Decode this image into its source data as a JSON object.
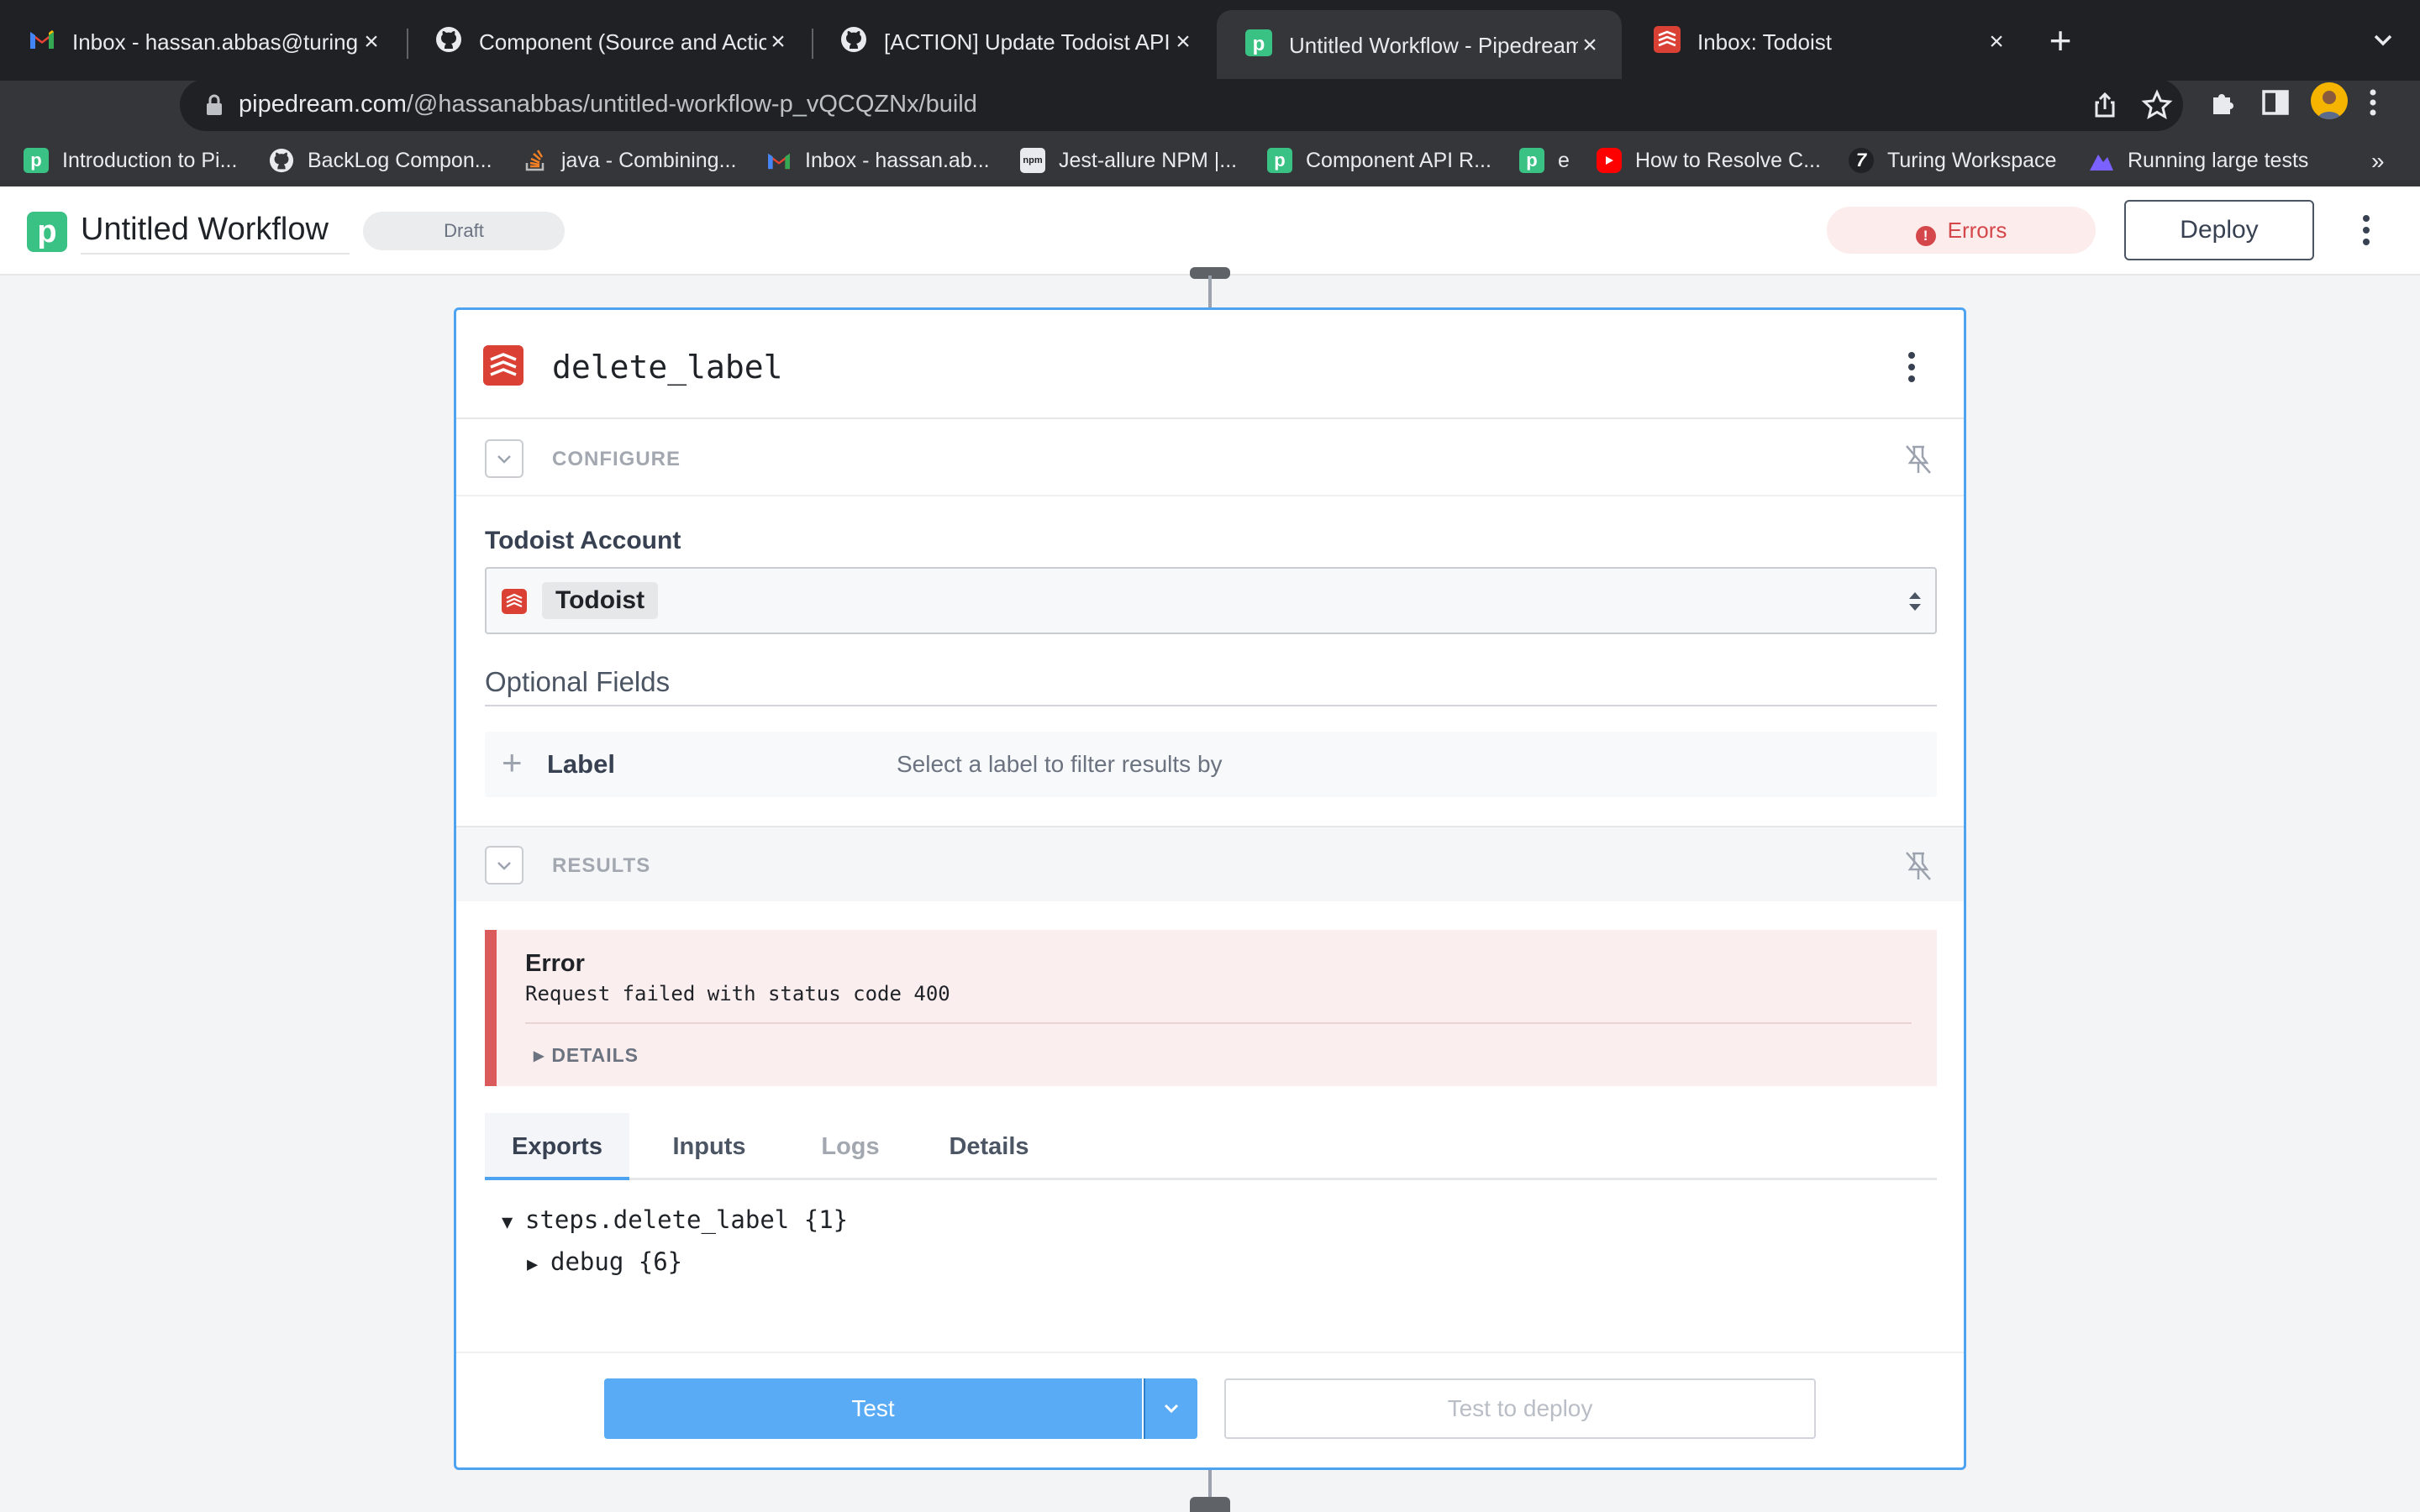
{
  "browser": {
    "tabs": [
      {
        "title": "Inbox - hassan.abbas@turing.c",
        "icon": "gmail-icon"
      },
      {
        "title": "Component (Source and Actior",
        "icon": "github-icon"
      },
      {
        "title": "[ACTION] Update Todoist API f",
        "icon": "github-icon"
      },
      {
        "title": "Untitled Workflow - Pipedream",
        "icon": "pipedream-icon"
      },
      {
        "title": "Inbox: Todoist",
        "icon": "todoist-icon"
      }
    ],
    "url_host": "pipedream.com",
    "url_path": "/@hassanabbas/untitled-workflow-p_vQCQZNx/build",
    "bookmarks": [
      {
        "label": "Introduction to Pi...",
        "icon": "pipedream-icon"
      },
      {
        "label": "BackLog Compon...",
        "icon": "github-icon"
      },
      {
        "label": "java - Combining...",
        "icon": "stackoverflow-icon"
      },
      {
        "label": "Inbox - hassan.ab...",
        "icon": "gmail-icon"
      },
      {
        "label": "Jest-allure NPM |...",
        "icon": "npm-icon"
      },
      {
        "label": "Component API R...",
        "icon": "pipedream-icon"
      },
      {
        "label": "e",
        "icon": "pipedream-icon"
      },
      {
        "label": "How to Resolve C...",
        "icon": "youtube-icon"
      },
      {
        "label": "Turing Workspace",
        "icon": "turing-icon"
      },
      {
        "label": "Running large tests",
        "icon": "mountain-icon"
      }
    ],
    "bookmarks_more": "»"
  },
  "app": {
    "logo_letter": "p",
    "workflow_title": "Untitled Workflow",
    "status": "Draft",
    "errors_label": "Errors",
    "deploy_label": "Deploy"
  },
  "step": {
    "name": "delete_label",
    "configure_label": "CONFIGURE",
    "account_label": "Todoist Account",
    "account_value": "Todoist",
    "optional_title": "Optional Fields",
    "optional_fields": [
      {
        "label": "Label",
        "description": "Select a label to filter results by"
      }
    ],
    "results_label": "RESULTS",
    "error": {
      "title": "Error",
      "message": "Request failed with status code 400",
      "details_label": "DETAILS"
    },
    "result_tabs": [
      {
        "label": "Exports",
        "state": "active"
      },
      {
        "label": "Inputs",
        "state": "normal"
      },
      {
        "label": "Logs",
        "state": "disabled"
      },
      {
        "label": "Details",
        "state": "normal"
      }
    ],
    "tree": [
      {
        "text": "steps.delete_label {1}",
        "expanded": true,
        "level": 0
      },
      {
        "text": "debug {6}",
        "expanded": false,
        "level": 1
      }
    ],
    "test_label": "Test",
    "test_deploy_label": "Test to deploy"
  },
  "colors": {
    "accent": "#4ea3f1",
    "todoist": "#db4035",
    "pipedream": "#3ac285",
    "error": "#d4474a"
  }
}
